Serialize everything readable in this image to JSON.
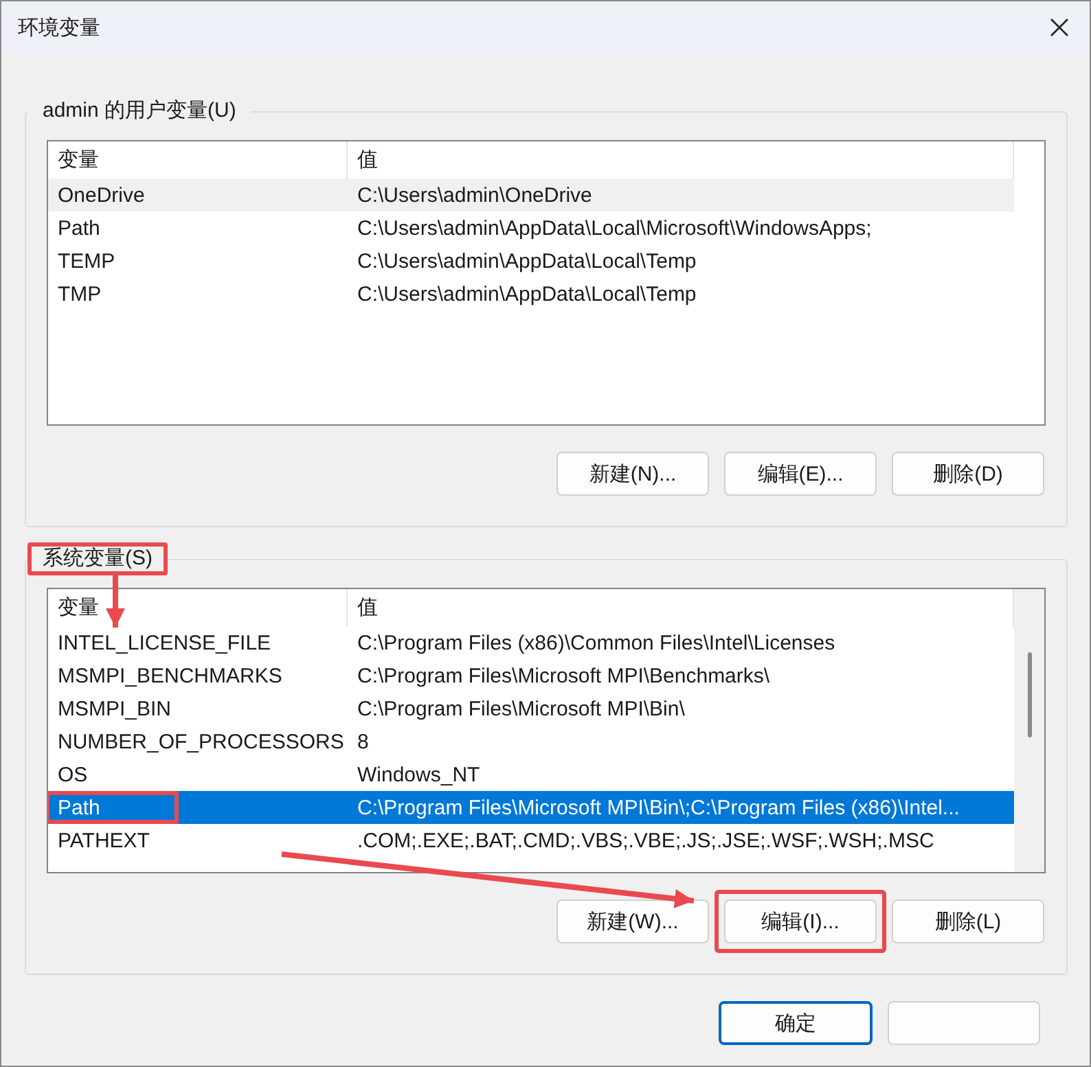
{
  "window": {
    "title": "环境变量"
  },
  "user_group": {
    "label": "admin 的用户变量(U)",
    "highlighted": false,
    "focused": false,
    "columns": [
      "变量",
      "值"
    ],
    "rows": [
      {
        "name": "OneDrive",
        "value": "C:\\Users\\admin\\OneDrive",
        "selected": true,
        "highlighted": false
      },
      {
        "name": "Path",
        "value": "C:\\Users\\admin\\AppData\\Local\\Microsoft\\WindowsApps;",
        "selected": false,
        "highlighted": false
      },
      {
        "name": "TEMP",
        "value": "C:\\Users\\admin\\AppData\\Local\\Temp",
        "selected": false,
        "highlighted": false
      },
      {
        "name": "TMP",
        "value": "C:\\Users\\admin\\AppData\\Local\\Temp",
        "selected": false,
        "highlighted": false
      }
    ],
    "buttons": [
      {
        "label": "新建(N)...",
        "highlighted": false
      },
      {
        "label": "编辑(E)...",
        "highlighted": false
      },
      {
        "label": "删除(D)",
        "highlighted": false
      }
    ]
  },
  "system_group": {
    "label": "系统变量(S)",
    "highlighted": true,
    "focused": true,
    "columns": [
      "变量",
      "值"
    ],
    "rows": [
      {
        "name": "INTEL_LICENSE_FILE",
        "value": "C:\\Program Files (x86)\\Common Files\\Intel\\Licenses",
        "selected": false,
        "highlighted": false
      },
      {
        "name": "MSMPI_BENCHMARKS",
        "value": "C:\\Program Files\\Microsoft MPI\\Benchmarks\\",
        "selected": false,
        "highlighted": false
      },
      {
        "name": "MSMPI_BIN",
        "value": "C:\\Program Files\\Microsoft MPI\\Bin\\",
        "selected": false,
        "highlighted": false
      },
      {
        "name": "NUMBER_OF_PROCESSORS",
        "value": "8",
        "selected": false,
        "highlighted": false
      },
      {
        "name": "OS",
        "value": "Windows_NT",
        "selected": false,
        "highlighted": false
      },
      {
        "name": "Path",
        "value": "C:\\Program Files\\Microsoft MPI\\Bin\\;C:\\Program Files (x86)\\Intel...",
        "selected": true,
        "highlighted": true
      },
      {
        "name": "PATHEXT",
        "value": ".COM;.EXE;.BAT;.CMD;.VBS;.VBE;.JS;.JSE;.WSF;.WSH;.MSC",
        "selected": false,
        "highlighted": false
      }
    ],
    "buttons": [
      {
        "label": "新建(W)...",
        "highlighted": false
      },
      {
        "label": "编辑(I)...",
        "highlighted": true
      },
      {
        "label": "删除(L)",
        "highlighted": false
      }
    ]
  },
  "footer_buttons": [
    {
      "label": "确定",
      "default": true
    },
    {
      "default": false
    }
  ],
  "arrows": {
    "down": true,
    "diagonal": true
  }
}
